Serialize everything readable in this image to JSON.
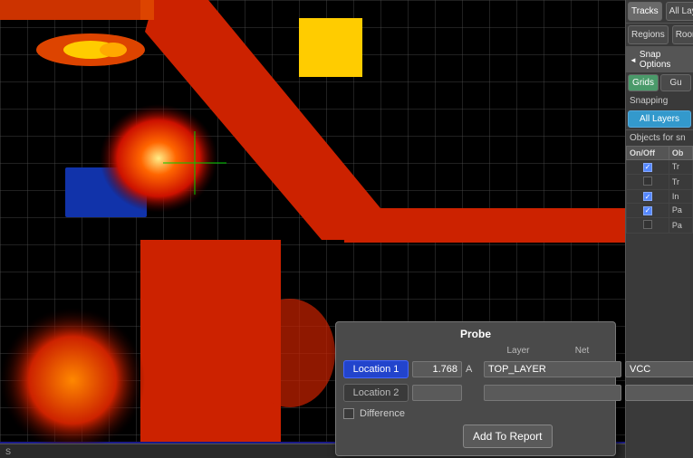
{
  "tabs": {
    "tracks": "Tracks",
    "all_layers": "All Layers",
    "regions": "Regions",
    "rooms": "Rooms"
  },
  "snap": {
    "header": "Snap Options",
    "grids": "Grids",
    "gu": "Gu",
    "snapping": "Snapping",
    "all_layers": "All Layers"
  },
  "objects": {
    "header": "Objects for sn",
    "col_on_off": "On/Off",
    "col_ob": "Ob",
    "rows": [
      {
        "checked": true,
        "label": "Tr"
      },
      {
        "checked": false,
        "label": "Tr"
      },
      {
        "checked": true,
        "label": "In"
      },
      {
        "checked": true,
        "label": "Pa"
      },
      {
        "checked": false,
        "label": "Pa"
      }
    ]
  },
  "probe": {
    "title": "Probe",
    "col_layer": "Layer",
    "col_net": "Net",
    "location1": {
      "label": "Location 1",
      "value": "1.768",
      "unit": "A",
      "layer": "TOP_LAYER",
      "net": "VCC"
    },
    "location2": {
      "label": "Location 2",
      "value": "",
      "unit": "",
      "layer": "",
      "net": ""
    },
    "difference": "Difference",
    "add_to_report": "Add To Report"
  }
}
